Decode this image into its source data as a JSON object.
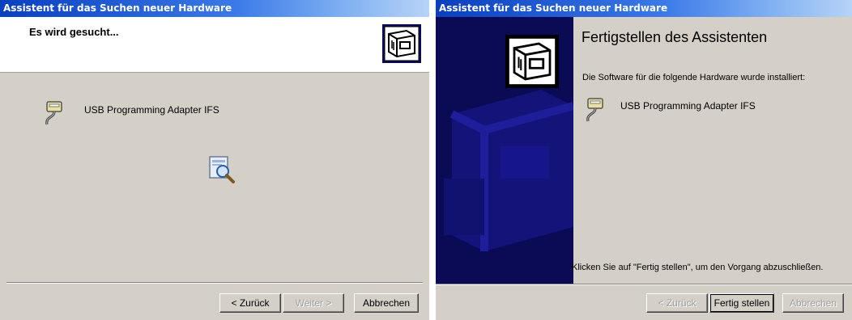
{
  "window1": {
    "title": "Assistent für das Suchen neuer Hardware",
    "header_title": "Es wird gesucht...",
    "device_name": "USB Programming Adapter IFS",
    "buttons": {
      "back": "< Zurück",
      "next": "Weiter >",
      "cancel": "Abbrechen"
    }
  },
  "window2": {
    "title": "Assistent für das Suchen neuer Hardware",
    "heading": "Fertigstellen des Assistenten",
    "intro": "Die Software für die folgende Hardware wurde installiert:",
    "device_name": "USB Programming Adapter IFS",
    "finish_hint": "Klicken Sie auf \"Fertig stellen\", um den Vorgang abzuschließen.",
    "buttons": {
      "back": "< Zurück",
      "finish": "Fertig stellen",
      "cancel": "Abbrechen"
    }
  },
  "icons": {
    "hardware": "hardware-wizard-icon",
    "usb": "usb-cable-icon",
    "search": "magnifier-search-icon"
  },
  "colors": {
    "titlebar_start": "#0a3fbf",
    "titlebar_end": "#b7d3f7",
    "dialog_face": "#d4d0c8",
    "side_panel": "#0a0a55"
  }
}
